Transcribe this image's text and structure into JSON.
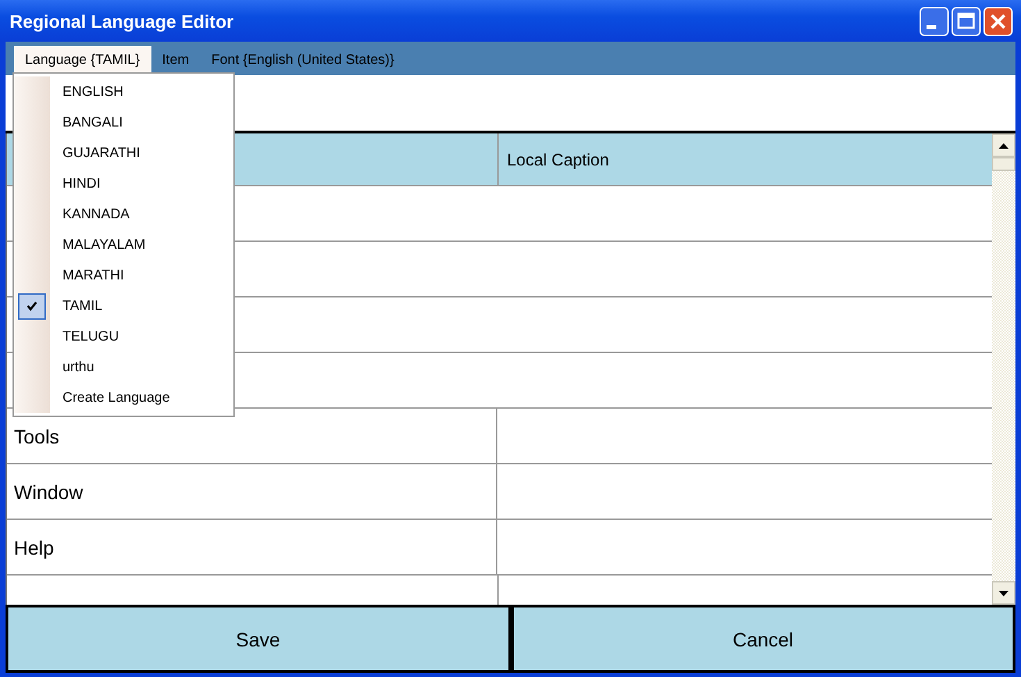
{
  "window": {
    "title": "Regional Language Editor"
  },
  "menu": [
    {
      "label": "Language {TAMIL}",
      "selected": true
    },
    {
      "label": "Item",
      "selected": false
    },
    {
      "label": "Font {English (United States)}",
      "selected": false
    }
  ],
  "language_menu": [
    {
      "label": "ENGLISH",
      "checked": false
    },
    {
      "label": "BANGALI",
      "checked": false
    },
    {
      "label": "GUJARATHI",
      "checked": false
    },
    {
      "label": "HINDI",
      "checked": false
    },
    {
      "label": "KANNADA",
      "checked": false
    },
    {
      "label": "MALAYALAM",
      "checked": false
    },
    {
      "label": "MARATHI",
      "checked": false
    },
    {
      "label": "TAMIL",
      "checked": true
    },
    {
      "label": "TELUGU",
      "checked": false
    },
    {
      "label": "urthu",
      "checked": false
    },
    {
      "label": "Create Language",
      "checked": false
    }
  ],
  "table": {
    "columns": [
      "Local Caption"
    ],
    "rows": [
      {
        "caption": "Tools"
      },
      {
        "caption": "Window"
      },
      {
        "caption": "Help"
      }
    ]
  },
  "buttons": [
    "Save",
    "Cancel"
  ]
}
